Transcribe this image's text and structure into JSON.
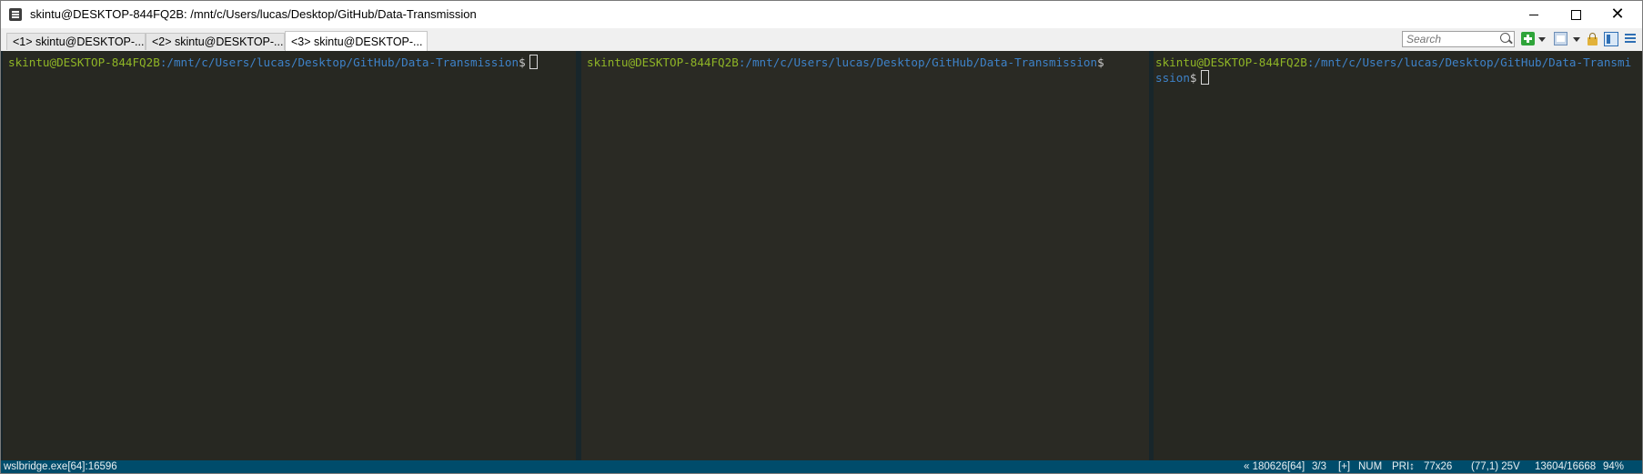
{
  "window": {
    "title": "skintu@DESKTOP-844FQ2B: /mnt/c/Users/lucas/Desktop/GitHub/Data-Transmission"
  },
  "tabs": [
    {
      "label": "<1> skintu@DESKTOP-...",
      "active": false
    },
    {
      "label": "<2> skintu@DESKTOP-...",
      "active": false
    },
    {
      "label": "<3> skintu@DESKTOP-...",
      "active": true
    }
  ],
  "toolbar": {
    "search_placeholder": "Search",
    "icons": [
      "plus-icon",
      "dropdown-caret-icon",
      "console-icon",
      "lock-icon",
      "split-panes-icon",
      "hamburger-menu-icon"
    ]
  },
  "panes": [
    {
      "user_host": "skintu@DESKTOP-844FQ2B",
      "path": ":/mnt/c/Users/lucas/Desktop/GitHub/Data-Transmission",
      "dollar": "$"
    },
    {
      "user_host": "skintu@DESKTOP-844FQ2B",
      "path": ":/mnt/c/Users/lucas/Desktop/GitHub/Data-Transmission",
      "dollar": "$"
    },
    {
      "user_host": "skintu@DESKTOP-844FQ2B",
      "path": ":/mnt/c/Users/lucas/Desktop/GitHub/Data-Transmission",
      "dollar": "$"
    }
  ],
  "statusbar": {
    "process": "wslbridge.exe[64]:16596",
    "pid": "« 180626[64]",
    "tabs": "3/3",
    "plus": "[+]",
    "num": "NUM",
    "pri": "PRI↕",
    "size": "77x26",
    "pos": "(77,1) 25V",
    "mem": "13604/16668",
    "zoom": "94%"
  },
  "colors": {
    "user_host": "#8fb526",
    "path": "#3e82c8",
    "terminal_bg": "#272822",
    "statusbar_bg": "#004c6b"
  }
}
